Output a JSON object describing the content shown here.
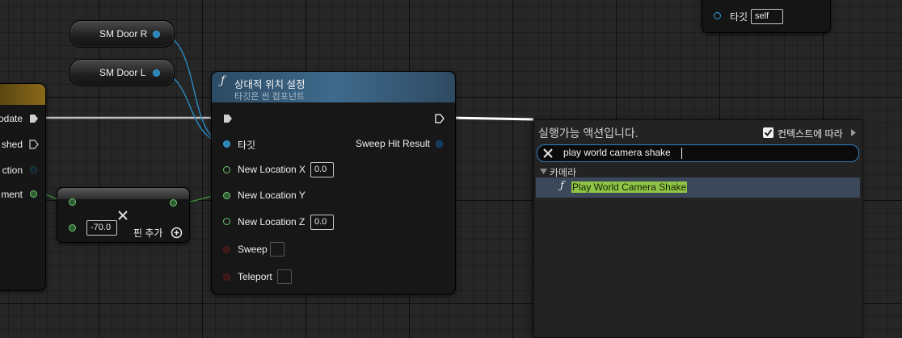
{
  "top_right_node": {
    "target_label": "타깃",
    "target_value": "self"
  },
  "sm_door_r": {
    "label": "SM Door R"
  },
  "sm_door_l": {
    "label": "SM Door L"
  },
  "left_node": {
    "pins": [
      "odate",
      "shed",
      "ction",
      "ment"
    ]
  },
  "add_node": {
    "value": "-70.0",
    "add_pin_label": "핀 추가"
  },
  "set_location_node": {
    "title": "상대적 위치 설정",
    "subtitle": "타깃은 씬 컴포넌트",
    "target_label": "타깃",
    "sweep_hit_result_label": "Sweep Hit Result",
    "new_location_x_label": "New Location X",
    "new_location_x_value": "0.0",
    "new_location_y_label": "New Location Y",
    "new_location_z_label": "New Location Z",
    "new_location_z_value": "0.0",
    "sweep_label": "Sweep",
    "teleport_label": "Teleport"
  },
  "action_menu": {
    "title": "실행가능 액션입니다.",
    "context_label": "컨텍스트에 따라",
    "context_checked": true,
    "search_value": "play world camera shake",
    "category": "카메라",
    "result_item": "Play World Camera Shake"
  },
  "colors": {
    "object_pin": "#2b84b8",
    "float_pin": "#74c773",
    "highlight": "#8ac24a",
    "selection": "#3c4a5a",
    "node_header": "#315a7a"
  },
  "icons": [
    "function-icon",
    "close-icon",
    "checkbox-check-icon",
    "chevron-right-icon",
    "triangle-down-icon",
    "plus-circle-icon",
    "x-icon"
  ]
}
